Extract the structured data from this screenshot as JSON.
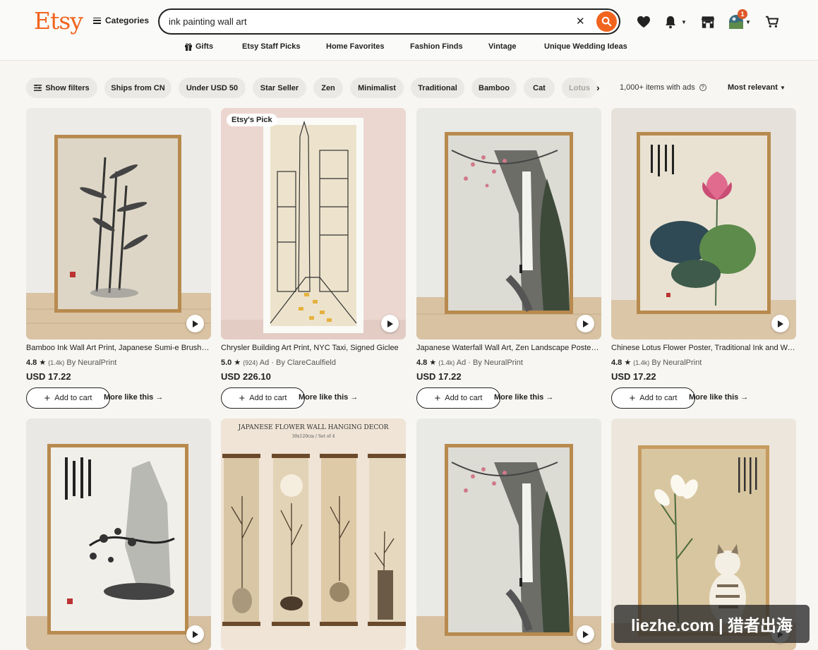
{
  "header": {
    "logo": "Etsy",
    "categories_label": "Categories",
    "search_value": "ink painting wall art",
    "notification_count": "1"
  },
  "nav": [
    "Gifts",
    "Etsy Staff Picks",
    "Home Favorites",
    "Fashion Finds",
    "Vintage",
    "Unique Wedding Ideas"
  ],
  "filters": {
    "show_filters": "Show filters",
    "chips": [
      "Ships from CN",
      "Under USD 50",
      "Star Seller",
      "Zen",
      "Minimalist",
      "Traditional",
      "Bamboo",
      "Cat",
      "Lotus"
    ],
    "items_count": "1,000+ items with ads",
    "sort": "Most relevant"
  },
  "listings": [
    {
      "title": "Bamboo Ink Wall Art Print, Japanese Sumi-e Brush Painting",
      "rating": "4.8",
      "reviews": "(1.4k)",
      "ad": "",
      "seller": "By NeuralPrint",
      "price": "USD 17.22",
      "badge": ""
    },
    {
      "title": "Chrysler Building Art Print, NYC Taxi, Signed Giclee",
      "rating": "5.0",
      "reviews": "(924)",
      "ad": "Ad ·",
      "seller": "By ClareCaulfield",
      "price": "USD 226.10",
      "badge": "Etsy's Pick"
    },
    {
      "title": "Japanese Waterfall Wall Art, Zen Landscape Poster Print",
      "rating": "4.8",
      "reviews": "(1.4k)",
      "ad": "Ad ·",
      "seller": "By NeuralPrint",
      "price": "USD 17.22",
      "badge": ""
    },
    {
      "title": "Chinese Lotus Flower Poster, Traditional Ink and Wash Art",
      "rating": "4.8",
      "reviews": "(1.4k)",
      "ad": "",
      "seller": "By NeuralPrint",
      "price": "USD 17.22",
      "badge": ""
    }
  ],
  "second_row": {
    "scroll_title": "JAPANESE FLOWER WALL HANGING DECOR",
    "scroll_subtitle": "30x120cm / Set of 4"
  },
  "buttons": {
    "add_to_cart": "Add to cart",
    "more_like_this": "More like this"
  },
  "watermark": "liezhe.com | 猎者出海",
  "colors": {
    "brand": "#f1641e",
    "chip_bg": "#eae9e5",
    "background": "#f7f6f3"
  }
}
